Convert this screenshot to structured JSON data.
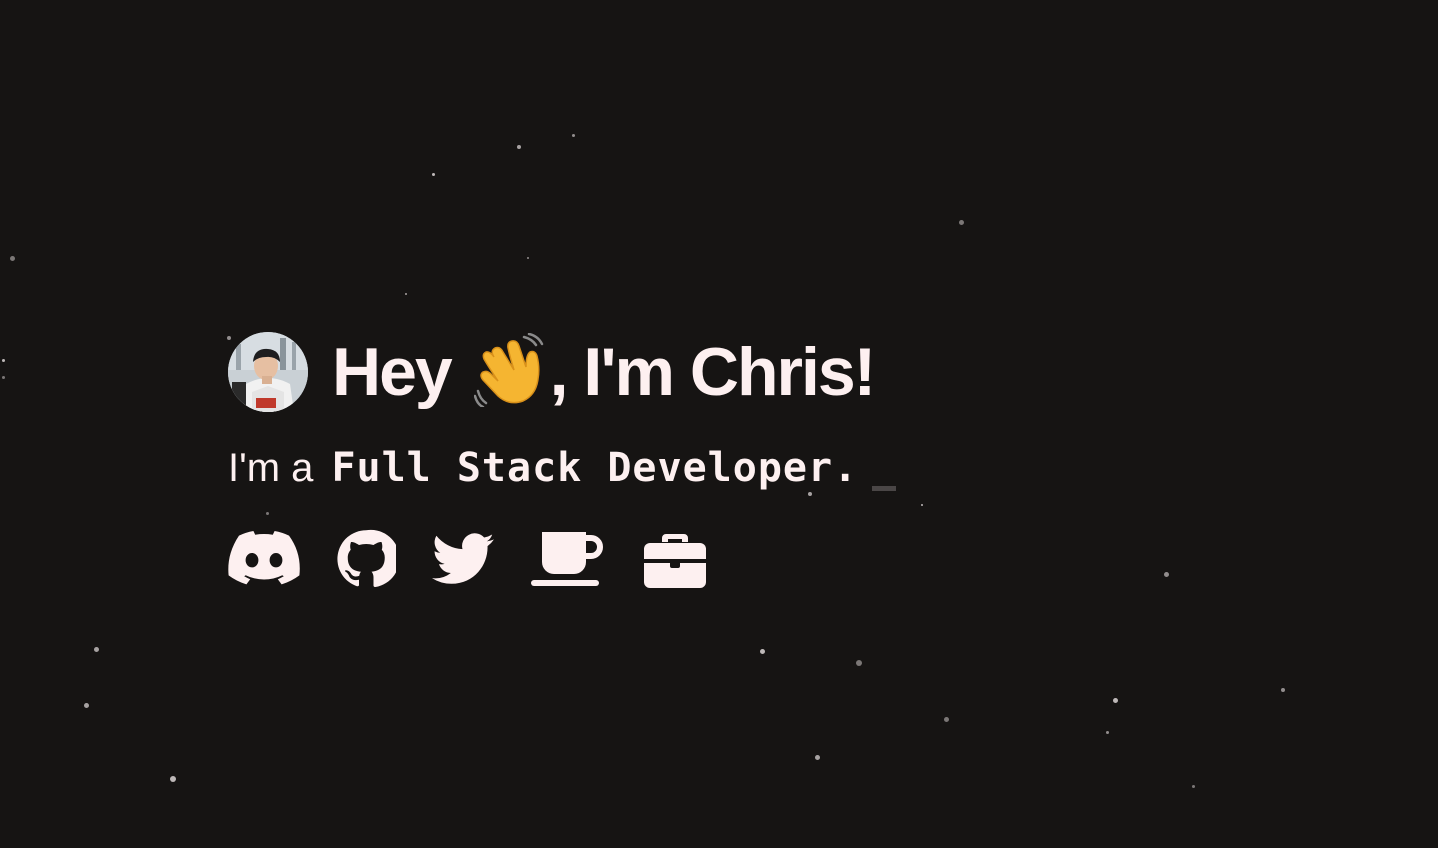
{
  "hero": {
    "greeting_before": "Hey ",
    "greeting_after": ", I'm Chris!",
    "wave_icon": "waving-hand-emoji",
    "avatar_icon": "profile-photo",
    "subtitle_prefix": "I'm a",
    "subtitle_role": "Full Stack Developer."
  },
  "socials": [
    {
      "icon": "discord-icon"
    },
    {
      "icon": "github-icon"
    },
    {
      "icon": "twitter-icon"
    },
    {
      "icon": "coffee-icon"
    },
    {
      "icon": "briefcase-icon"
    }
  ],
  "colors": {
    "background": "#161413",
    "text": "#fdf0f0",
    "star": "#cfc9c9",
    "cursor": "#4a4646",
    "wave_emoji": "#f5b531"
  }
}
